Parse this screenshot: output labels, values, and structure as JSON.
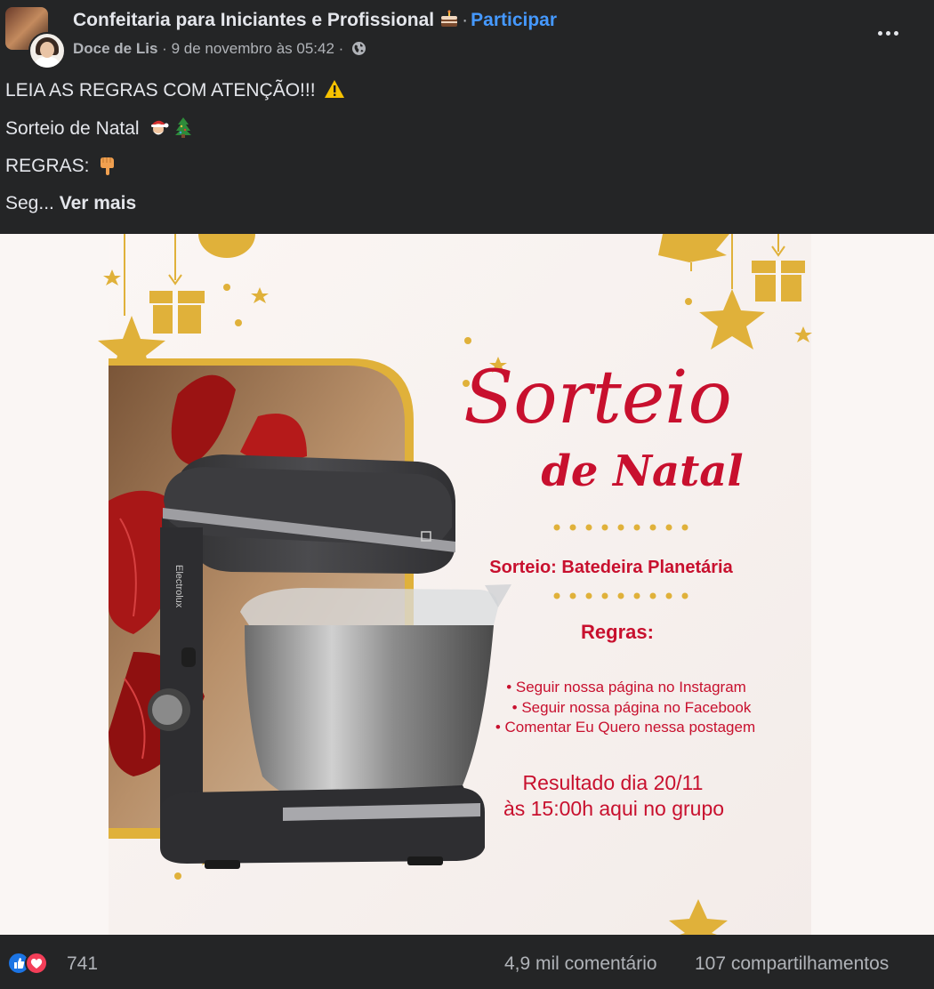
{
  "post": {
    "group_name": "Confeitaria para Iniciantes e Profissional",
    "join_label": "Participar",
    "author": "Doce de Lis",
    "timestamp": "9 de novembro às 05:42",
    "lines": [
      "LEIA AS REGRAS COM ATENÇÃO!!!",
      "Sorteio de Natal",
      "REGRAS:",
      "Seg..."
    ],
    "see_more": "Ver mais"
  },
  "image": {
    "title_script": "Sorteio",
    "title_sub": "de Natal",
    "prize": "Sorteio: Batedeira Planetária",
    "rules_heading": "Regras:",
    "rules": [
      "• Seguir nossa página no Instagram",
      "• Seguir nossa página no Facebook",
      "• Comentar Eu Quero nessa postagem"
    ],
    "result_line1": "Resultado dia 20/11",
    "result_line2": "às 15:00h aqui no grupo",
    "brand_text": "Electrolux"
  },
  "footer": {
    "reaction_count": "741",
    "comments": "4,9 mil comentário",
    "shares": "107 compartilhamentos"
  },
  "icons": [
    "cake-emoji",
    "globe-icon",
    "more-icon",
    "warning-emoji",
    "santa-emoji",
    "tree-emoji",
    "point-down-emoji",
    "like-icon",
    "love-icon"
  ],
  "colors": {
    "background": "#242526",
    "accent_link": "#4599ff",
    "poster_red": "#c8102e",
    "poster_gold": "#e0b13a"
  }
}
